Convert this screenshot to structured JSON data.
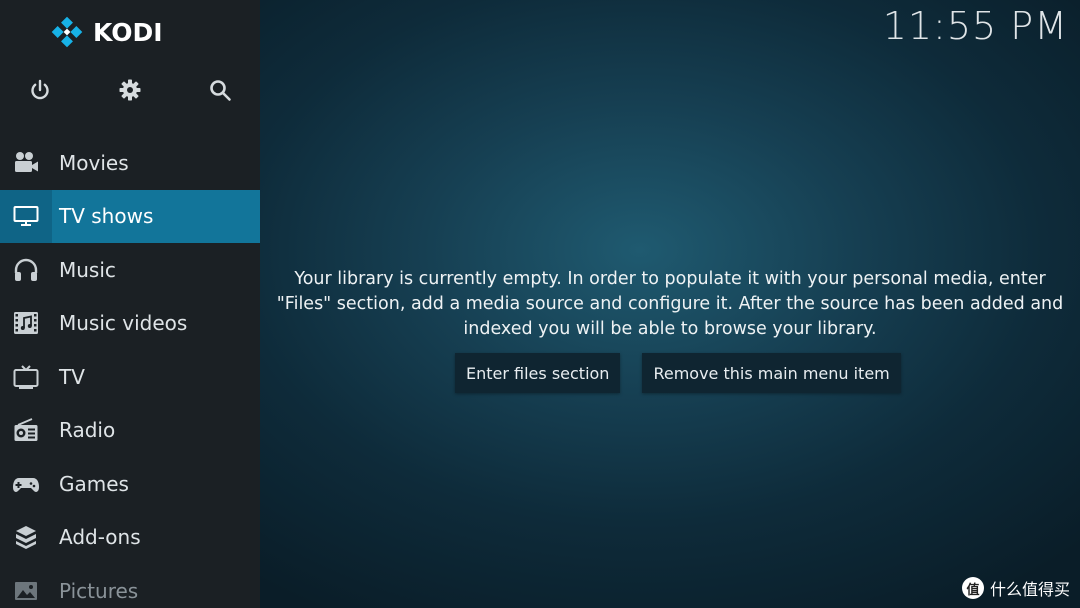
{
  "app": {
    "logo_text": "KODI",
    "clock": "11:55 PM"
  },
  "colors": {
    "sidebar_bg": "#1b2024",
    "active_item": "#12759a",
    "logo_blue": "#17b2e7"
  },
  "top_buttons": [
    {
      "name": "power",
      "icon": "power-icon"
    },
    {
      "name": "settings",
      "icon": "gear-icon"
    },
    {
      "name": "search",
      "icon": "search-icon"
    }
  ],
  "menu": {
    "items": [
      {
        "label": "Movies",
        "icon": "movie-camera-icon",
        "active": false
      },
      {
        "label": "TV shows",
        "icon": "monitor-icon",
        "active": true
      },
      {
        "label": "Music",
        "icon": "headphones-icon",
        "active": false
      },
      {
        "label": "Music videos",
        "icon": "music-video-icon",
        "active": false
      },
      {
        "label": "TV",
        "icon": "tv-icon",
        "active": false
      },
      {
        "label": "Radio",
        "icon": "radio-icon",
        "active": false
      },
      {
        "label": "Games",
        "icon": "gamepad-icon",
        "active": false
      },
      {
        "label": "Add-ons",
        "icon": "addons-box-icon",
        "active": false
      },
      {
        "label": "Pictures",
        "icon": "pictures-icon",
        "active": false
      }
    ]
  },
  "content": {
    "empty_message": "Your library is currently empty. In order to populate it with your personal media, enter \"Files\" section, add a media source and configure it. After the source has been added and indexed you will be able to browse your library.",
    "enter_files_label": "Enter files section",
    "remove_item_label": "Remove this main menu item"
  },
  "watermark": {
    "badge": "值",
    "text": "什么值得买"
  }
}
